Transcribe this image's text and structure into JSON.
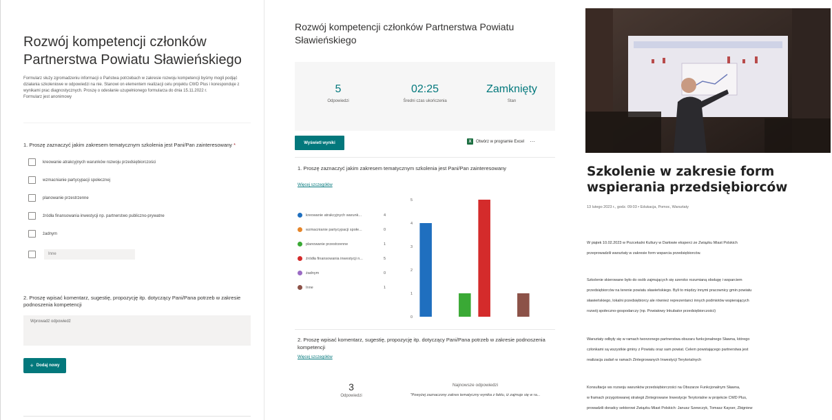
{
  "form": {
    "title": "Rozwój kompetencji członków Partnerstwa Powiatu Sławieńskiego",
    "description": [
      "Formularz służy zgromadzeniu informacji o Państwa potrzebach w zakresie rozwoju kompetencji byśmy mogli podjąć",
      "działania szkoleniowe w odpowiedzi na nie. Stanowi on elementem realizacji celu projektu CWD Plus i koresponduje z",
      "wynikami prac diagnostycznych. Proszę o odesłanie uzupełnionego formularza do dnia 15.11.2022 r.",
      "Formularz jest anonimowy"
    ],
    "question1": "1. Proszę zaznaczyć jakim zakresem tematycznym szkolenia jest Pani/Pan zainteresowany",
    "required_mark": "*",
    "options": [
      "kreowanie atrakcyjnych warunków rozwoju przedsiębiorczości",
      "wzmacnianie partycypacji społecznej",
      "planowanie przestrzenne",
      "źródła finansowania inwestycji np. partnerstwo publiczno-prywatne",
      "żadnym"
    ],
    "other_placeholder": "Inne",
    "question2": "2. Proszę wpisać komentarz, sugestię, propozycję itp. dotyczący Pani/Pana potrzeb w zakresie podnoszenia kompetencji",
    "answer_placeholder": "Wprowadź odpowiedź",
    "add_new_label": "Dodaj nowy",
    "add_new_icon": "+"
  },
  "results": {
    "title": "Rozwój kompetencji członków Partnerstwa Powiatu Sławieńskiego",
    "stats": [
      {
        "value": "5",
        "label": "Odpowiedzi"
      },
      {
        "value": "02:25",
        "label": "Średni czas ukończenia"
      },
      {
        "value": "Zamknięty",
        "label": "Stan"
      }
    ],
    "view_results_label": "Wyświetl wyniki",
    "excel_label": "Otwórz w programie Excel",
    "excel_icon": "X",
    "more_icon": "···",
    "question1": "1. Proszę zaznaczyć jakim zakresem tematycznym szkolenia jest Pani/Pan zainteresowany",
    "more_details": "Więcej szczegółów",
    "legend": [
      {
        "label": "kreowanie atrakcyjnych warunk...",
        "count": "4",
        "color": "#1f6fbf"
      },
      {
        "label": "wzmacnianie partycypacji społe...",
        "count": "0",
        "color": "#e6862a"
      },
      {
        "label": "planowanie przestrzenne",
        "count": "1",
        "color": "#3aa935"
      },
      {
        "label": "źródła finansowania inwestycji n...",
        "count": "5",
        "color": "#d42b2b"
      },
      {
        "label": "żadnym",
        "count": "0",
        "color": "#9b6bc4"
      },
      {
        "label": "Inne",
        "count": "1",
        "color": "#8c5248"
      }
    ],
    "question2": "2. Proszę wpisać komentarz, sugestię, propozycję itp. dotyczący Pani/Pana potrzeb w zakresie podnoszenia kompetencji",
    "more_details2": "Więcej szczegółów",
    "responses_count": "3",
    "responses_label": "Odpowiedzi",
    "latest_label": "Najnowsze odpowiedzi",
    "latest_quote": "\"Powyżej zaznaczony zakres tematyczny wynika z faktu, iż zajmuje się w ra..."
  },
  "chart_data": {
    "type": "bar",
    "categories": [
      "kreowanie atrakcyjnych warunk...",
      "wzmacnianie partycypacji społe...",
      "planowanie przestrzenne",
      "źródła finansowania inwestycji n...",
      "żadnym",
      "Inne"
    ],
    "values": [
      4,
      0,
      1,
      5,
      0,
      1
    ],
    "colors": [
      "#1f6fbf",
      "#e6862a",
      "#3aa935",
      "#d42b2b",
      "#9b6bc4",
      "#8c5248"
    ],
    "yticks": [
      "0",
      "1",
      "2",
      "3",
      "4",
      "5"
    ],
    "ylim": [
      0,
      5
    ],
    "grid": false,
    "legend": "left"
  },
  "article": {
    "title": "Szkolenie w zakresie form wspierania przedsiębiorców",
    "meta": "13 lutego 2023 r., godz. 09:03 • Edukacja, Pomoc, Warsztaty",
    "paragraphs": [
      [
        "W piątek 10.02.2023 w Pozcekalni Kultury w Darłowie eksperci ze Związku Miast Polskich",
        "przeprowadzili warsztaty w zakresie form wsparcia przedsiębiorców."
      ],
      [
        "Szkolenie skierowane było do osób zajmujących się szeroko rozumianą obsługę i wsparciem",
        "przedsiębiorców na terenie powiatu sławieńskiego. Byli to między innymi pracownicy gmin powiatu",
        "sławieńskiego, lokalni przedsiębiorcy ale również reprezentanci innych podmiotów wspierających",
        "rozwój społeczno-gospodarczy (np. Powiatowy Inkubator przedsiębiorczości)"
      ],
      [
        "Warsztaty odbyły się w ramach tworzonego partnerstwa obszaru funkcjonalnego Sławna, którego",
        "członkami są wszystkie gminy z Powiatu oraz sam powiat. Celem powstającego partnerstwa jest",
        "realizacja zadań w ramach Zintegrowanych Inwestycji Terytorialnych"
      ],
      [
        "Konsultacje ws rozwoju warunków przedsiębiorczości na Obszarze Funkcjonalnym Sławna,",
        "w framach przygotowanej strategii Zintegrowane Inwestycje Terytorialne w projekcie CWD Plus,",
        "prowadzili doradcy sektorowi Związku Miast Polskich: Janusz Szewczyk, Tomasz Kayser, Zbigniew"
      ]
    ]
  }
}
